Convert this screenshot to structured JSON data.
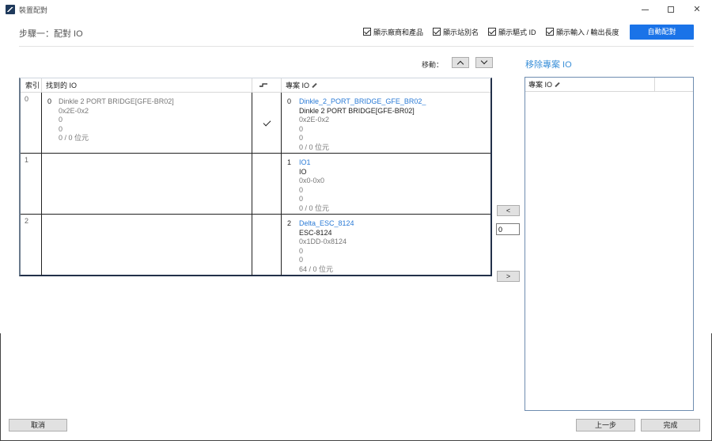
{
  "window": {
    "title": "裝置配對"
  },
  "header": {
    "step_title": "步驟一：配對 IO",
    "checkboxes": [
      {
        "label": "顯示廠商和產品",
        "checked": true
      },
      {
        "label": "顯示站別名",
        "checked": true
      },
      {
        "label": "顯示驅式 ID",
        "checked": true
      },
      {
        "label": "顯示輸入 / 輸出長度",
        "checked": true
      }
    ],
    "auto_match": "自動配對"
  },
  "move": {
    "label": "移動："
  },
  "table": {
    "headers": {
      "index": "索引",
      "found": "找到的 IO",
      "project": "專案 IO"
    },
    "rows": [
      {
        "index": "0",
        "found": {
          "num": "0",
          "name": "Dinkle 2 PORT BRIDGE[GFE-BR02]",
          "range": "0x2E-0x2",
          "v1": "0",
          "v2": "0",
          "bits": "0 / 0 位元"
        },
        "matched": true,
        "project": {
          "num": "0",
          "link": "Dinkle_2_PORT_BRIDGE_GFE_BR02_",
          "name": "Dinkle 2 PORT BRIDGE[GFE-BR02]",
          "range": "0x2E-0x2",
          "v1": "0",
          "v2": "0",
          "bits": "0 / 0 位元"
        }
      },
      {
        "index": "1",
        "matched": false,
        "project": {
          "num": "1",
          "link": "IO1",
          "name": "IO",
          "range": "0x0-0x0",
          "v1": "0",
          "v2": "0",
          "bits": "0 / 0 位元"
        }
      },
      {
        "index": "2",
        "matched": false,
        "project": {
          "num": "2",
          "link": "Delta_ESC_8124",
          "name": "ESC-8124",
          "range": "0x1DD-0x8124",
          "v1": "0",
          "v2": "0",
          "bits": "64 / 0 位元"
        }
      }
    ]
  },
  "side": {
    "left_btn": "<",
    "right_btn": ">",
    "input_value": "0"
  },
  "remove_panel": {
    "title": "移除專案 IO",
    "header": "專案 IO"
  },
  "footer": {
    "cancel": "取消",
    "prev": "上一步",
    "finish": "完成"
  }
}
